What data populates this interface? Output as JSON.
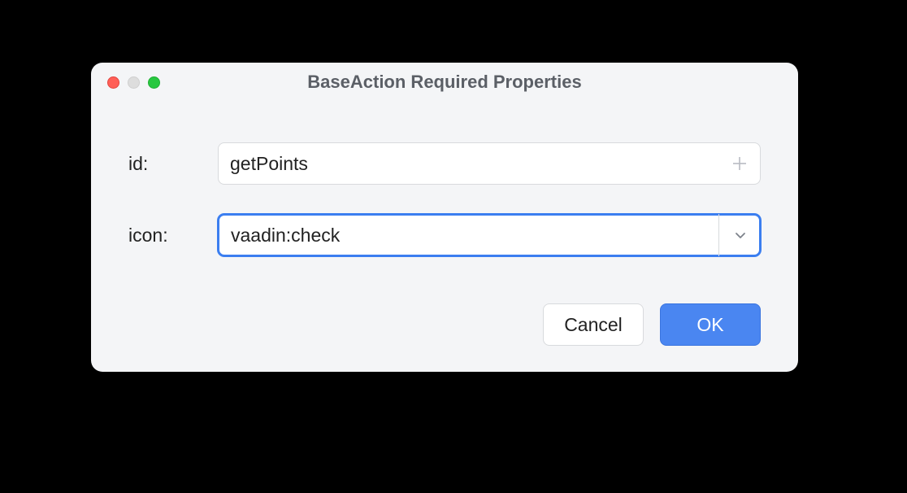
{
  "dialog": {
    "title": "BaseAction Required Properties",
    "fields": {
      "id": {
        "label": "id:",
        "value": "getPoints"
      },
      "icon": {
        "label": "icon:",
        "value": "vaadin:check"
      }
    },
    "buttons": {
      "cancel": "Cancel",
      "ok": "OK"
    }
  }
}
